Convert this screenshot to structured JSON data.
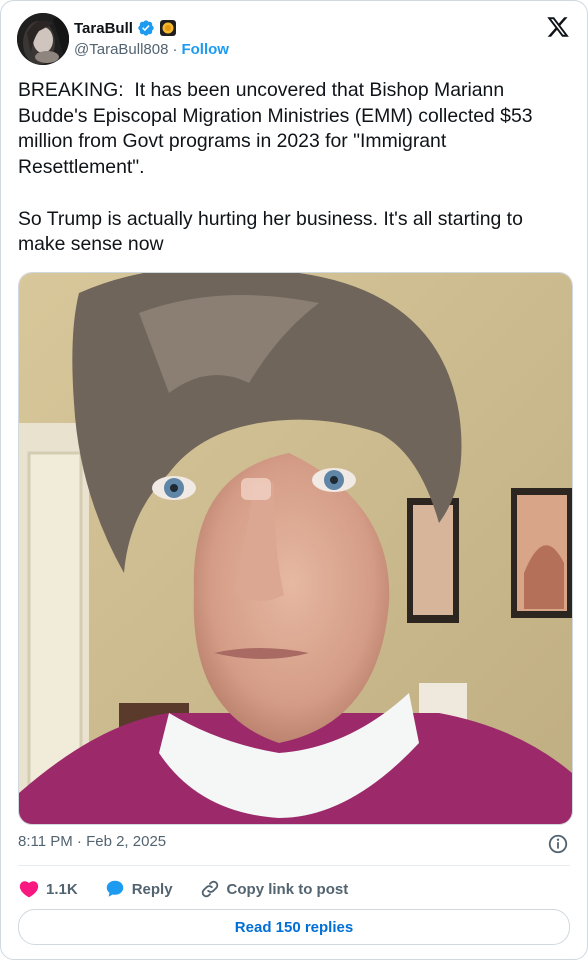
{
  "author": {
    "display_name": "TaraBull",
    "handle": "@TaraBull808",
    "separator": "·",
    "follow_label": "Follow"
  },
  "tweet": {
    "text": "BREAKING:  It has been uncovered that Bishop Mariann Budde's Episcopal Migration Ministries (EMM) collected $53 million from Govt programs in 2023 for \"Immigrant Resettlement\".\n\nSo Trump is actually hurting her business. It's all starting to make sense now",
    "timestamp": "8:11 PM · Feb 2, 2025"
  },
  "actions": {
    "like_count": "1.1K",
    "reply_label": "Reply",
    "copy_label": "Copy link to post"
  },
  "replies_button": "Read 150 replies",
  "icons": {
    "verified": "verified-badge-icon",
    "affiliate": "affiliate-badge-icon",
    "platform": "x-logo-icon",
    "info": "info-icon",
    "like": "heart-icon",
    "reply": "speech-bubble-icon",
    "copy": "link-icon"
  },
  "colors": {
    "accent": "#1d9bf0",
    "like": "#f91880",
    "text": "#0f1419",
    "muted": "#536471",
    "link_button": "#006fd6"
  }
}
